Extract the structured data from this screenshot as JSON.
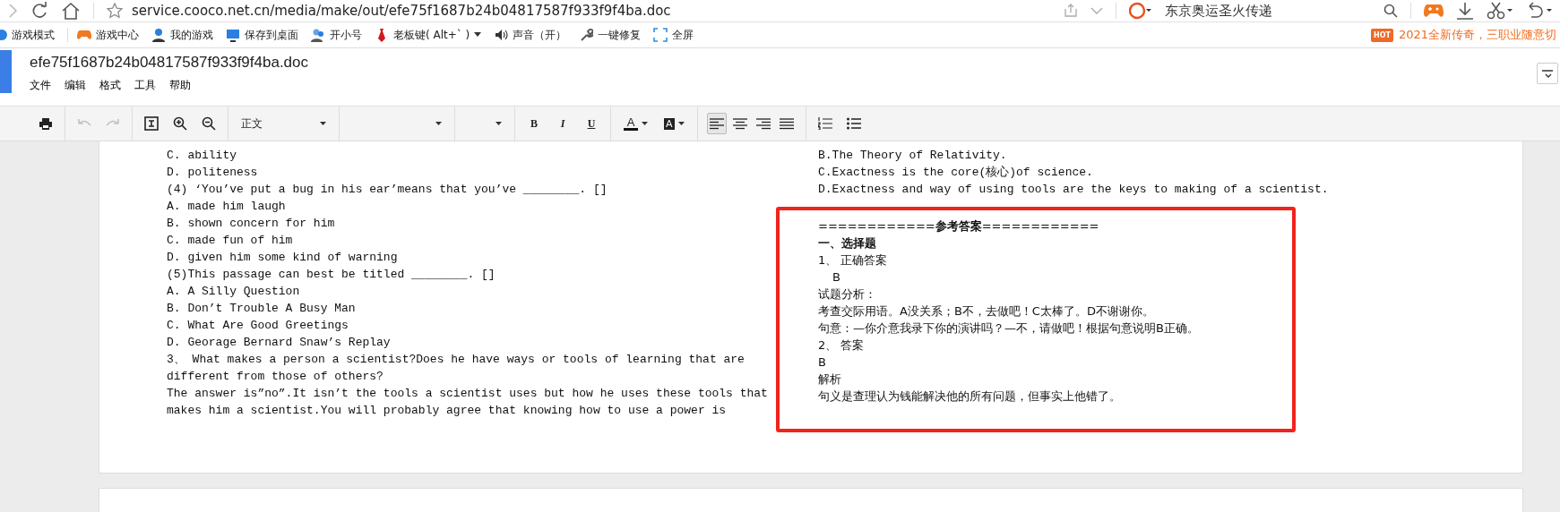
{
  "browser": {
    "address": "service.cooco.net.cn/media/make/out/efe75f1687b24b04817587f933f9f4ba.doc",
    "search_text": "东京奥运圣火传递"
  },
  "bookmarks": [
    {
      "label": "游戏模式"
    },
    {
      "label": "游戏中心"
    },
    {
      "label": "我的游戏"
    },
    {
      "label": "保存到桌面"
    },
    {
      "label": "开小号"
    },
    {
      "label": "老板键( Alt+` )"
    },
    {
      "label": "声音（开）"
    },
    {
      "label": "一键修复"
    },
    {
      "label": "全屏"
    }
  ],
  "promo": {
    "badge": "HOT",
    "text": "2021全新传奇，三职业随意切"
  },
  "app": {
    "title": "efe75f1687b24b04817587f933f9f4ba.doc",
    "menus": [
      "文件",
      "编辑",
      "格式",
      "工具",
      "帮助"
    ]
  },
  "toolbar": {
    "style_select": "正文",
    "undo_disabled": true,
    "redo_disabled": true,
    "bold": "B",
    "italic": "I",
    "underline": "U",
    "font_color": "A",
    "highlight": "A",
    "alignments": [
      {
        "kind": "left",
        "selected": true
      },
      {
        "kind": "center",
        "selected": false
      },
      {
        "kind": "right",
        "selected": false
      },
      {
        "kind": "justify",
        "selected": false
      }
    ]
  },
  "document": {
    "left_lines": [
      "C. ability",
      "D. politeness",
      "(4) ‘You’ve put a bug in his ear’means that you’ve ________. []",
      "A. made him laugh",
      "B. shown concern for him",
      "C. made fun of him",
      "D. given him some kind of warning",
      "(5)This passage can best be titled ________. []",
      "A. A Silly Question",
      "B. Don’t Trouble A Busy Man",
      "C. What Are Good Greetings",
      "D. Georage Bernard Snaw’s Replay",
      "3、 What makes a person a scientist?Does he have ways or tools of learning that are",
      "different from those of others?",
      "The answer is”no”.It isn’t the tools a scientist uses but how he uses these tools that",
      "makes him a scientist.You will probably agree that knowing how to use a power is"
    ],
    "right_lines": [
      "B.The Theory of Relativity.",
      "C.Exactness is the core(核心)of science.",
      "D.Exactness and way of using tools are the keys to making of a scientist."
    ],
    "answers": {
      "heading": "============**参考答案**============",
      "section": "一、选择题",
      "lines": [
        {
          "kind": "plain",
          "text": "1、 正确答案"
        },
        {
          "kind": "indent",
          "text": "B"
        },
        {
          "kind": "plain",
          "text": "试题分析："
        },
        {
          "kind": "plain",
          "text": "考查交际用语。A没关系；B不，去做吧！C太棒了。D不谢谢你。"
        },
        {
          "kind": "plain",
          "text": "句意：—你介意我录下你的演讲吗？—不，请做吧！根据句意说明B正确。"
        },
        {
          "kind": "plain",
          "text": "2、 答案"
        },
        {
          "kind": "plain",
          "text": "B"
        },
        {
          "kind": "plain",
          "text": "解析"
        },
        {
          "kind": "plain",
          "text": "句义是查理认为钱能解决他的所有问题，但事实上他错了。"
        }
      ]
    }
  }
}
